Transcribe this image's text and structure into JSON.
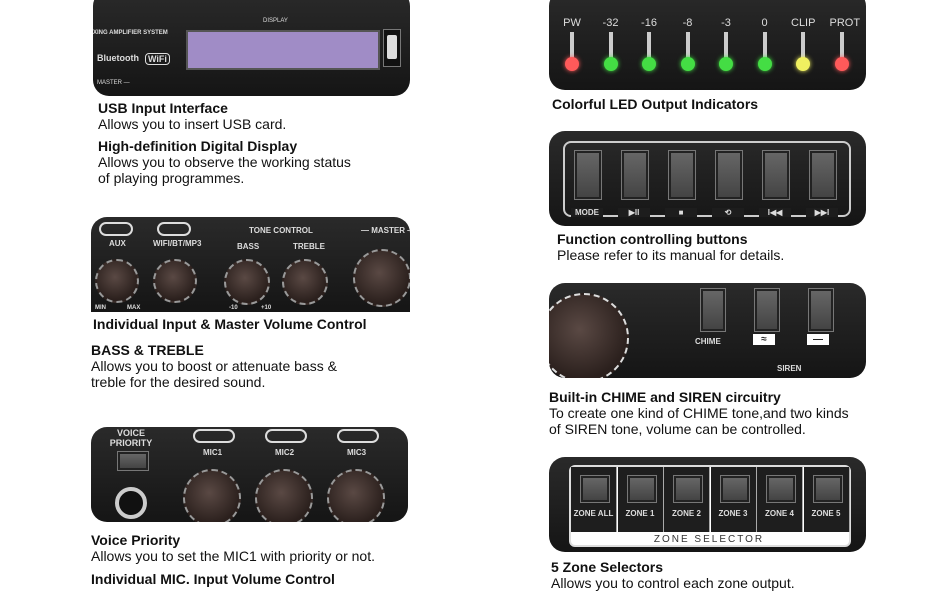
{
  "panel_display": {
    "brand_text": "XING AMPLIFIER SYSTEM",
    "bluetooth": "Bluetooth",
    "wifi": "WiFi",
    "display_label": "DISPLAY",
    "master": "MASTER —",
    "usb_symbol": "⭠"
  },
  "panel_volume": {
    "aux": "AUX",
    "wifi_bt": "WIFI/BT/MP3",
    "tone": "TONE CONTROL",
    "bass": "BASS",
    "treble": "TREBLE",
    "master": "— MASTER —",
    "min": "MIN",
    "max": "MAX",
    "m10": "-10",
    "p10": "+10"
  },
  "panel_mic": {
    "voice": "VOICE",
    "priority": "PRIORITY",
    "mic1": "MIC1",
    "mic2": "MIC2",
    "mic3": "MIC3"
  },
  "panel_led": {
    "labels": [
      "PW",
      "-32",
      "-16",
      "-8",
      "-3",
      "0",
      "CLIP",
      "PROT"
    ],
    "colors": [
      "#ff5a5a",
      "#44dd44",
      "#44dd44",
      "#44dd44",
      "#44dd44",
      "#44dd44",
      "#f0f060",
      "#ff5a5a"
    ]
  },
  "panel_func": {
    "labels": [
      "MODE",
      "▶II",
      "■",
      "⟲",
      "I◀◀",
      "▶▶I"
    ]
  },
  "panel_chime": {
    "chime": "CHIME",
    "siren": "SIREN",
    "wave": "≈",
    "flat": "—"
  },
  "panel_zone": {
    "zones": [
      "ZONE ALL",
      "ZONE 1",
      "ZONE 2",
      "ZONE 3",
      "ZONE 4",
      "ZONE 5"
    ],
    "title": "ZONE SELECTOR"
  },
  "features": {
    "usb_title": "USB Input Interface",
    "usb_desc": "Allows you to insert USB card.",
    "display_title": "High-definition Digital Display",
    "display_desc1": "Allows you to observe the working status",
    "display_desc2": "of playing programmes.",
    "volume_title": "Individual Input & Master Volume Control",
    "bass_title": "BASS & TREBLE",
    "bass_desc1": "Allows you to boost or attenuate bass &",
    "bass_desc2": "treble for the desired sound.",
    "voice_title": "Voice Priority",
    "voice_desc": "Allows you to set the MIC1 with priority or not.",
    "mic_title": "Individual MIC. Input Volume Control",
    "led_title": "Colorful LED Output Indicators",
    "func_title": "Function controlling buttons",
    "func_desc": "Please refer to its manual for details.",
    "chime_title": "Built-in CHIME and SIREN circuitry",
    "chime_desc1": "To create one kind of CHIME tone,and two kinds",
    "chime_desc2": "of SIREN tone, volume can be controlled.",
    "zone_title": "5 Zone Selectors",
    "zone_desc": "Allows you to control each zone output."
  }
}
